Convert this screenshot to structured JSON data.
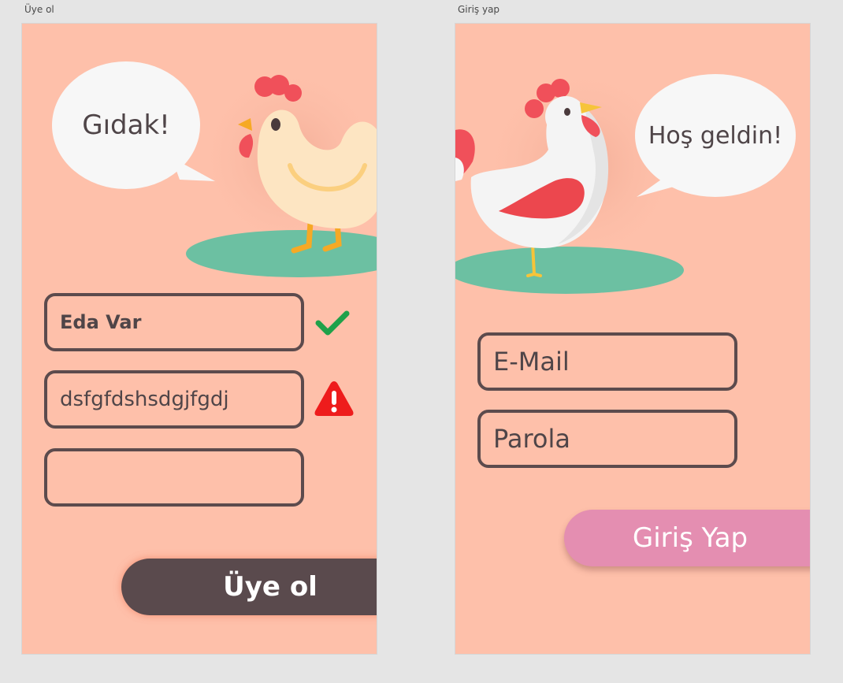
{
  "artboards": {
    "signup_title": "Üye ol",
    "login_title": "Giriş yap"
  },
  "signup": {
    "speech": "Gıdak!",
    "name_value": "Eda Var",
    "password_value": "dsfgfdshsdgjfgdj",
    "confirm_value": "",
    "button_label": "Üye ol",
    "name_status_icon": "checkmark-icon",
    "password_status_icon": "warning-icon"
  },
  "login": {
    "speech": "Hoş geldin!",
    "email_placeholder": "E-Mail",
    "password_placeholder": "Parola",
    "button_label": "Giriş Yap"
  },
  "colors": {
    "background": "#fec0aa",
    "field_border": "#5c4b4d",
    "signup_button": "#5a4a4d",
    "login_button": "#e48eb1",
    "check": "#1fa14a",
    "warning": "#ee1c1c",
    "ground": "#6cc0a2"
  }
}
